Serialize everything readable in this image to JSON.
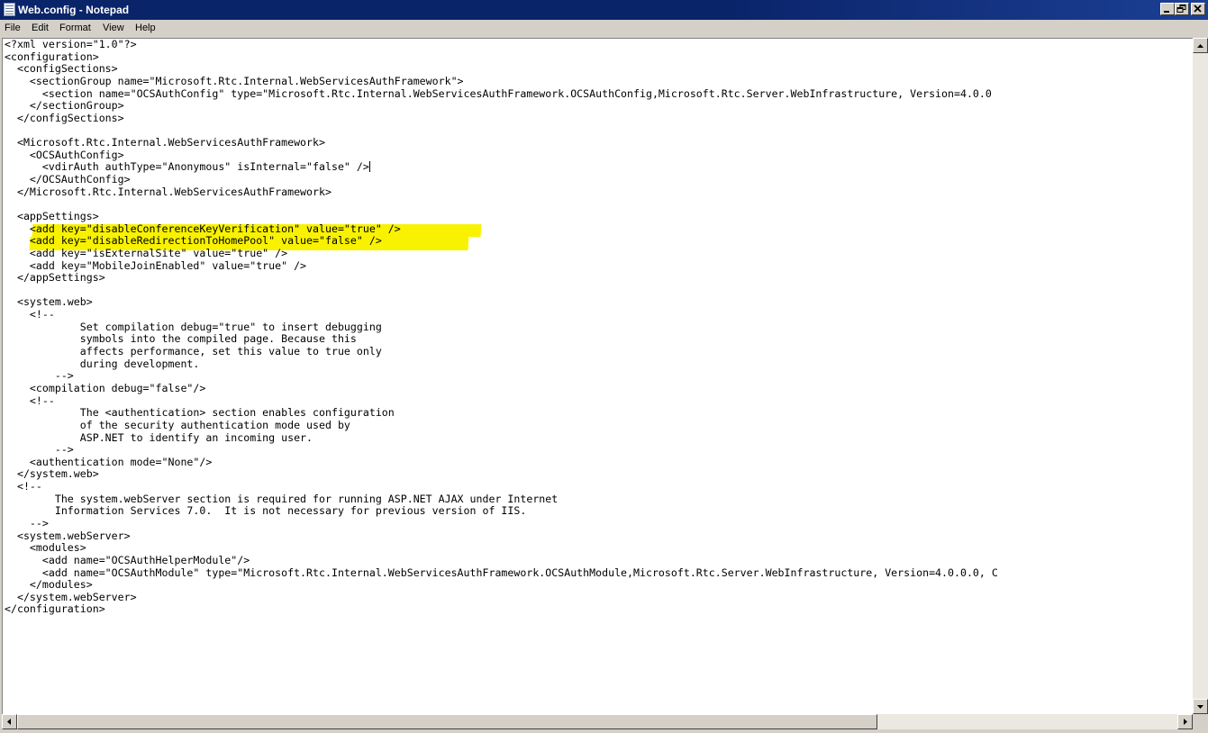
{
  "window": {
    "title": "Web.config - Notepad"
  },
  "menu": [
    "File",
    "Edit",
    "Format",
    "View",
    "Help"
  ],
  "editor": {
    "lines": [
      "<?xml version=\"1.0\"?>",
      "<configuration>",
      "  <configSections>",
      "    <sectionGroup name=\"Microsoft.Rtc.Internal.WebServicesAuthFramework\">",
      "      <section name=\"OCSAuthConfig\" type=\"Microsoft.Rtc.Internal.WebServicesAuthFramework.OCSAuthConfig,Microsoft.Rtc.Server.WebInfrastructure, Version=4.0.0",
      "    </sectionGroup>",
      "  </configSections>",
      "",
      "  <Microsoft.Rtc.Internal.WebServicesAuthFramework>",
      "    <OCSAuthConfig>",
      "      <vdirAuth authType=\"Anonymous\" isInternal=\"false\" />",
      "    </OCSAuthConfig>",
      "  </Microsoft.Rtc.Internal.WebServicesAuthFramework>",
      "",
      "  <appSettings>",
      "    <add key=\"disableConferenceKeyVerification\" value=\"true\" />",
      "    <add key=\"disableRedirectionToHomePool\" value=\"false\" />",
      "    <add key=\"isExternalSite\" value=\"true\" />",
      "    <add key=\"MobileJoinEnabled\" value=\"true\" />",
      "  </appSettings>",
      "",
      "  <system.web>",
      "    <!--",
      "            Set compilation debug=\"true\" to insert debugging",
      "            symbols into the compiled page. Because this",
      "            affects performance, set this value to true only",
      "            during development.",
      "        -->",
      "    <compilation debug=\"false\"/>",
      "    <!--",
      "            The <authentication> section enables configuration",
      "            of the security authentication mode used by",
      "            ASP.NET to identify an incoming user.",
      "        -->",
      "    <authentication mode=\"None\"/>",
      "  </system.web>",
      "  <!--",
      "        The system.webServer section is required for running ASP.NET AJAX under Internet",
      "        Information Services 7.0.  It is not necessary for previous version of IIS.",
      "    -->",
      "  <system.webServer>",
      "    <modules>",
      "      <add name=\"OCSAuthHelperModule\"/>",
      "      <add name=\"OCSAuthModule\" type=\"Microsoft.Rtc.Internal.WebServicesAuthFramework.OCSAuthModule,Microsoft.Rtc.Server.WebInfrastructure, Version=4.0.0.0, C",
      "    </modules>",
      "  </system.webServer>",
      "</configuration>"
    ],
    "highlight_color": "#f8f200"
  },
  "icons": {
    "app": "notepad-icon",
    "minimize": "minimize-icon",
    "maximize": "restore-icon",
    "close": "close-icon",
    "scroll_up": "arrow-up-icon",
    "scroll_down": "arrow-down-icon",
    "scroll_left": "arrow-left-icon",
    "scroll_right": "arrow-right-icon"
  }
}
